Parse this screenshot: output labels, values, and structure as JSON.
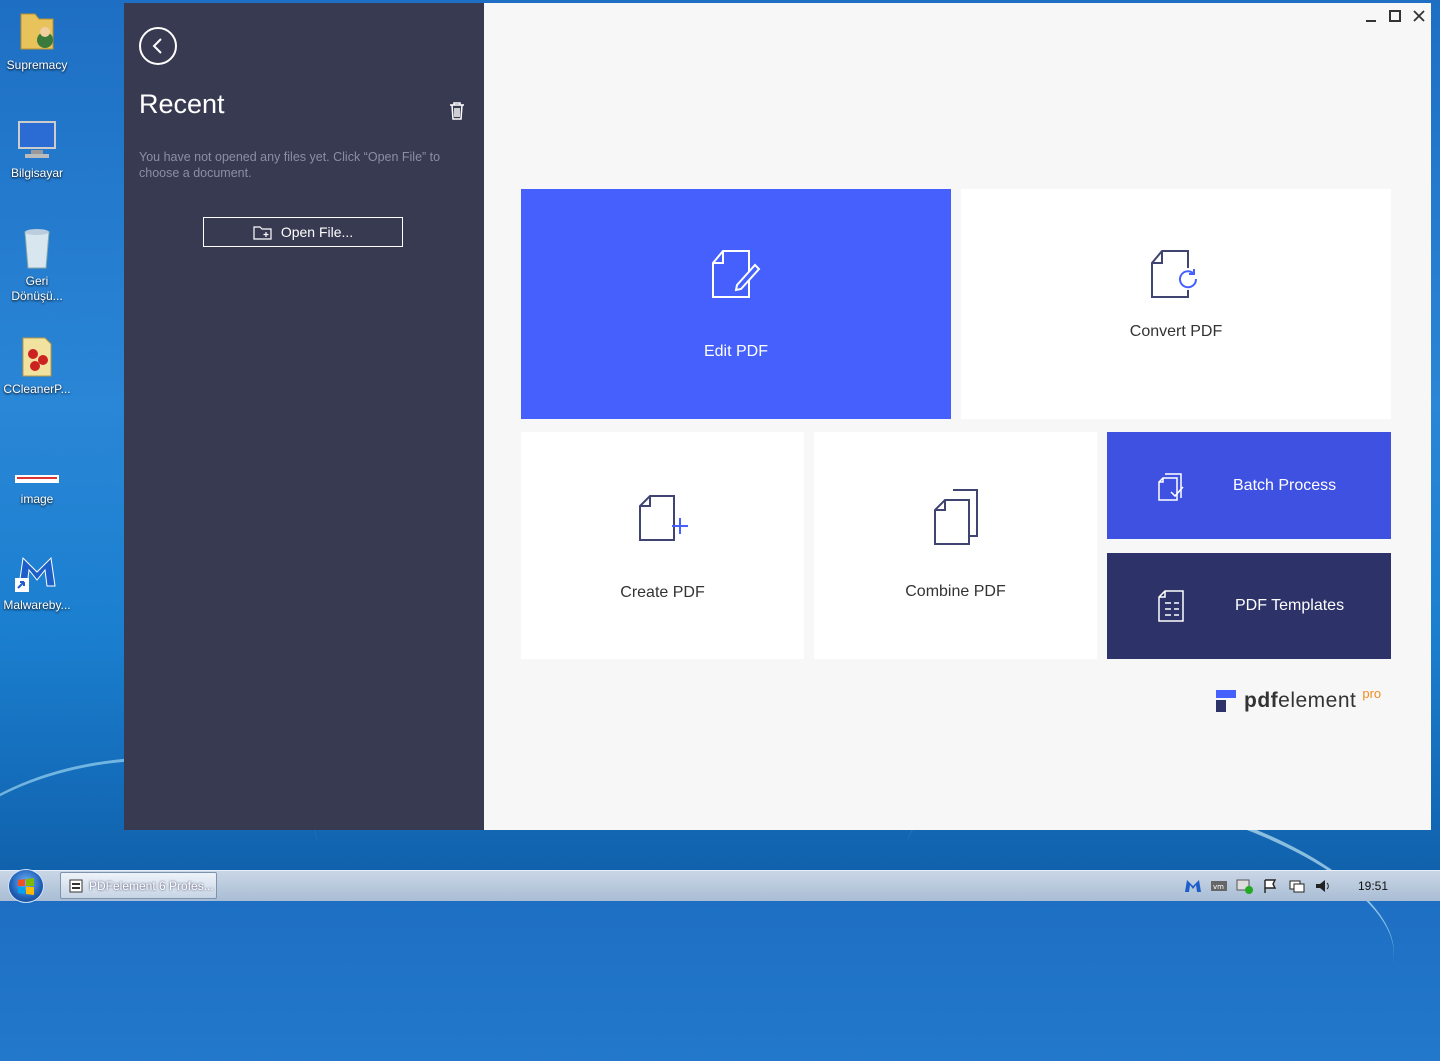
{
  "desktop": {
    "icons": [
      {
        "label": "Supremacy"
      },
      {
        "label": "Bilgisayar"
      },
      {
        "label": "Geri Dönüşü..."
      },
      {
        "label": "CCleanerP..."
      },
      {
        "label": "image"
      },
      {
        "label": "Malwareby..."
      }
    ]
  },
  "sidebar": {
    "title": "Recent",
    "empty_message": "You have not opened any files yet. Click “Open File” to choose a document.",
    "open_file_label": "Open File..."
  },
  "tiles": {
    "edit": "Edit PDF",
    "convert": "Convert PDF",
    "create": "Create PDF",
    "combine": "Combine PDF",
    "batch": "Batch Process",
    "templates": "PDF Templates"
  },
  "brand": {
    "name_bold": "pdf",
    "name_rest": "element",
    "edition": "pro"
  },
  "taskbar": {
    "task_label": "PDFelement 6 Profes...",
    "clock": "19:51"
  },
  "colors": {
    "sidebar_bg": "#383a52",
    "edit_tile": "#4560fd",
    "batch_tile": "#3f51e0",
    "templates_tile": "#2d3368",
    "brand_accent": "#f28c1f"
  }
}
